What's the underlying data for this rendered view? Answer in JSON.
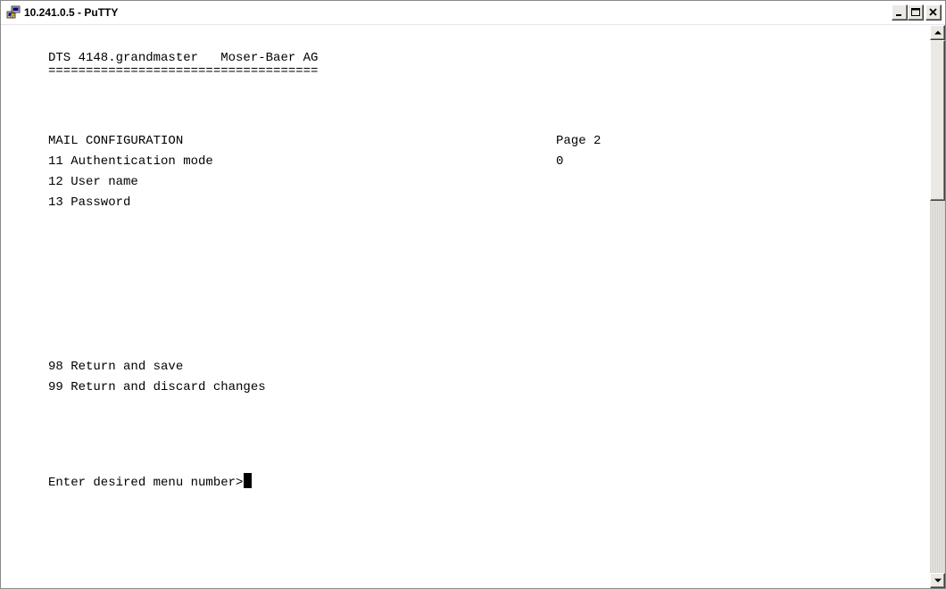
{
  "window": {
    "title": "10.241.0.5 - PuTTY",
    "icon": "putty-app-icon",
    "controls": [
      "minimize-icon",
      "maximize-icon",
      "close-icon"
    ]
  },
  "terminal": {
    "header_line": "DTS 4148.grandmaster   Moser-Baer AG",
    "separator": "====================================",
    "section_title": "MAIL CONFIGURATION",
    "page_label": "Page 2",
    "menu_items": [
      {
        "number": "11",
        "label": "Authentication mode",
        "value": "0",
        "text": "11 Authentication mode"
      },
      {
        "number": "12",
        "label": "User name",
        "value": "",
        "text": "12 User name"
      },
      {
        "number": "13",
        "label": "Password",
        "value": "",
        "text": "13 Password"
      }
    ],
    "return_items": [
      {
        "number": "98",
        "label": "Return and save",
        "text": "98 Return and save"
      },
      {
        "number": "99",
        "label": "Return and discard changes",
        "text": "99 Return and discard changes"
      }
    ],
    "prompt": "Enter desired menu number>"
  },
  "colors": {
    "terminal_background": "#ffffff",
    "terminal_foreground": "#000000",
    "cursor": "#000000"
  }
}
